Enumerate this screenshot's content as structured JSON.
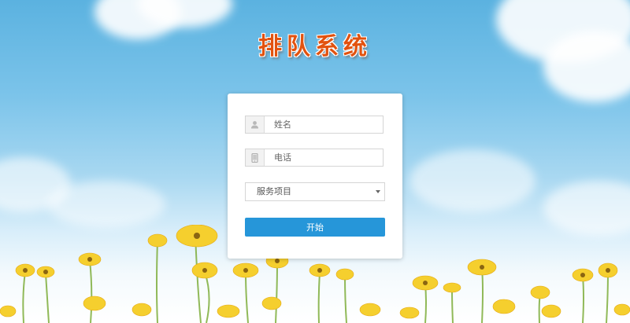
{
  "app": {
    "title": "排队系统"
  },
  "form": {
    "name_placeholder": "姓名",
    "phone_placeholder": "电话",
    "service_selected": "服务项目",
    "start_label": "开始"
  },
  "icons": {
    "name": "user-icon",
    "phone": "phone-icon",
    "select": "chevron-down-icon"
  },
  "colors": {
    "title": "#e2520f",
    "button": "#2696d9",
    "sky_top": "#5bb2e0"
  }
}
